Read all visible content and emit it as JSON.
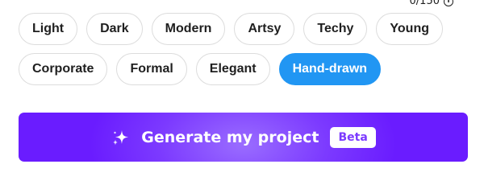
{
  "counter": {
    "text": "0/150"
  },
  "style_chips": {
    "row1": [
      "Light",
      "Dark",
      "Modern",
      "Artsy",
      "Techy",
      "Young"
    ],
    "row2": [
      "Corporate",
      "Formal",
      "Elegant",
      "Hand-drawn"
    ],
    "selected": "Hand-drawn"
  },
  "generate_button": {
    "label": "Generate my project",
    "badge": "Beta",
    "icon": "sparkle-icon"
  },
  "colors": {
    "selected_chip": "#2196f3",
    "generate_button": "#7c3aff"
  }
}
